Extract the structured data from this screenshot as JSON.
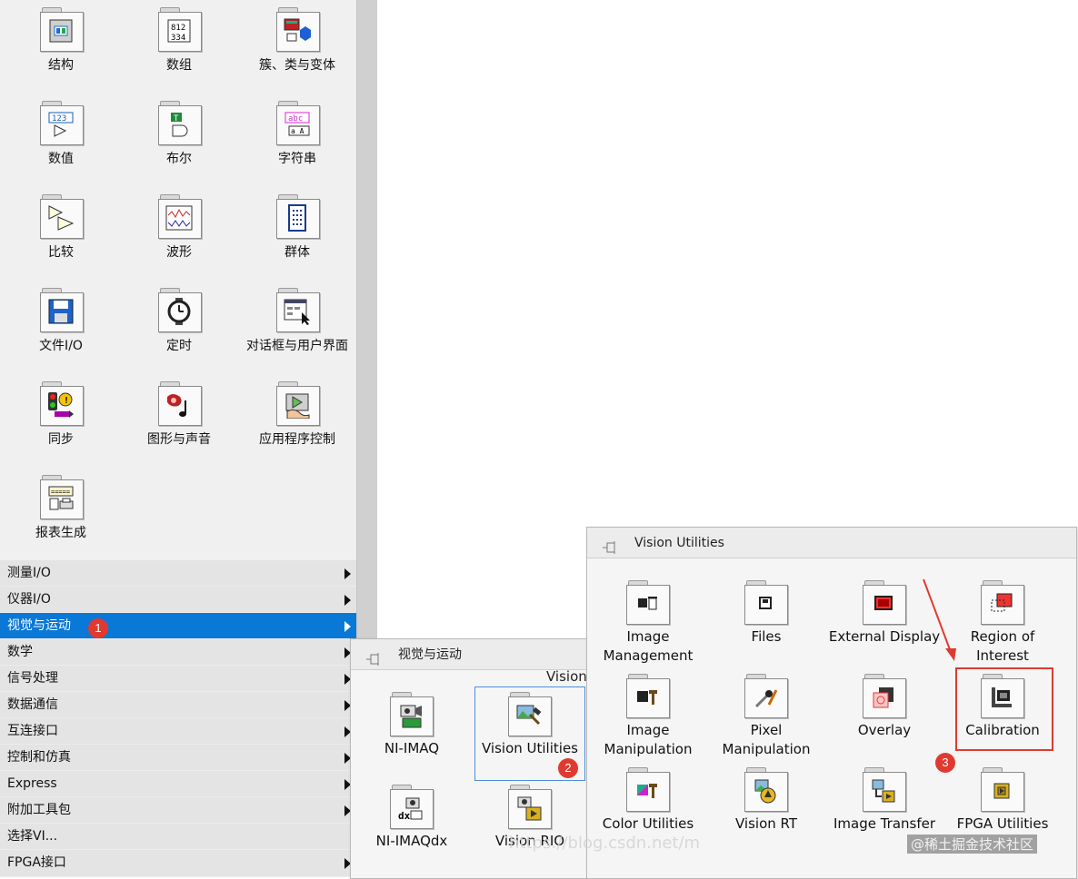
{
  "palette": {
    "items": [
      {
        "label": "结构",
        "icon": "structures-icon"
      },
      {
        "label": "数组",
        "icon": "array-icon"
      },
      {
        "label": "簇、类与变体",
        "icon": "cluster-class-variant-icon"
      },
      {
        "label": "数值",
        "icon": "numeric-icon"
      },
      {
        "label": "布尔",
        "icon": "boolean-icon"
      },
      {
        "label": "字符串",
        "icon": "string-icon"
      },
      {
        "label": "比较",
        "icon": "comparison-icon"
      },
      {
        "label": "波形",
        "icon": "waveform-icon"
      },
      {
        "label": "群体",
        "icon": "cluster-group-icon"
      },
      {
        "label": "文件I/O",
        "icon": "file-io-icon"
      },
      {
        "label": "定时",
        "icon": "timing-icon"
      },
      {
        "label": "对话框与用户界面",
        "icon": "dialog-ui-icon"
      },
      {
        "label": "同步",
        "icon": "synchronization-icon"
      },
      {
        "label": "图形与声音",
        "icon": "graphics-sound-icon"
      },
      {
        "label": "应用程序控制",
        "icon": "application-control-icon"
      },
      {
        "label": "报表生成",
        "icon": "report-generation-icon"
      }
    ]
  },
  "menu": {
    "items": [
      {
        "label": "测量I/O",
        "has_arrow": true
      },
      {
        "label": "仪器I/O",
        "has_arrow": true
      },
      {
        "label": "视觉与运动",
        "has_arrow": true,
        "active": true
      },
      {
        "label": "数学",
        "has_arrow": true
      },
      {
        "label": "信号处理",
        "has_arrow": true
      },
      {
        "label": "数据通信",
        "has_arrow": true
      },
      {
        "label": "互连接口",
        "has_arrow": true
      },
      {
        "label": "控制和仿真",
        "has_arrow": true
      },
      {
        "label": "Express",
        "has_arrow": true
      },
      {
        "label": "附加工具包",
        "has_arrow": true
      },
      {
        "label": "选择VI...",
        "has_arrow": false
      },
      {
        "label": "FPGA接口",
        "has_arrow": true
      }
    ],
    "active_color": "#0a78d7"
  },
  "vision_motion_panel": {
    "title": "视觉与运动",
    "partial_label": "Vision",
    "items": [
      {
        "label": "NI-IMAQ",
        "icon": "ni-imaq-icon"
      },
      {
        "label": "Vision Utilities",
        "icon": "vision-utilities-icon",
        "selected": true
      },
      {
        "label": "NI-IMAQdx",
        "icon": "ni-imaqdx-icon"
      },
      {
        "label": "Vision RIO",
        "icon": "vision-rio-icon"
      }
    ]
  },
  "vision_utilities_panel": {
    "title": "Vision Utilities",
    "items": [
      {
        "label": "Image Management",
        "icon": "image-management-icon"
      },
      {
        "label": "Files",
        "icon": "files-icon"
      },
      {
        "label": "External Display",
        "icon": "external-display-icon"
      },
      {
        "label": "Region of Interest",
        "icon": "region-of-interest-icon"
      },
      {
        "label": "Image Manipulation",
        "icon": "image-manipulation-icon"
      },
      {
        "label": "Pixel Manipulation",
        "icon": "pixel-manipulation-icon"
      },
      {
        "label": "Overlay",
        "icon": "overlay-icon"
      },
      {
        "label": "Calibration",
        "icon": "calibration-icon",
        "highlighted": true
      },
      {
        "label": "Color Utilities",
        "icon": "color-utilities-icon"
      },
      {
        "label": "Vision RT",
        "icon": "vision-rt-icon"
      },
      {
        "label": "Image Transfer",
        "icon": "image-transfer-icon"
      },
      {
        "label": "FPGA Utilities",
        "icon": "fpga-utilities-icon"
      }
    ]
  },
  "annotations": {
    "step1": "1",
    "step2": "2",
    "step3": "3",
    "highlight_color": "#e03a30"
  },
  "watermark": {
    "url_text": "https://blog.csdn.net/m",
    "community_text": "@稀土掘金技术社区"
  }
}
